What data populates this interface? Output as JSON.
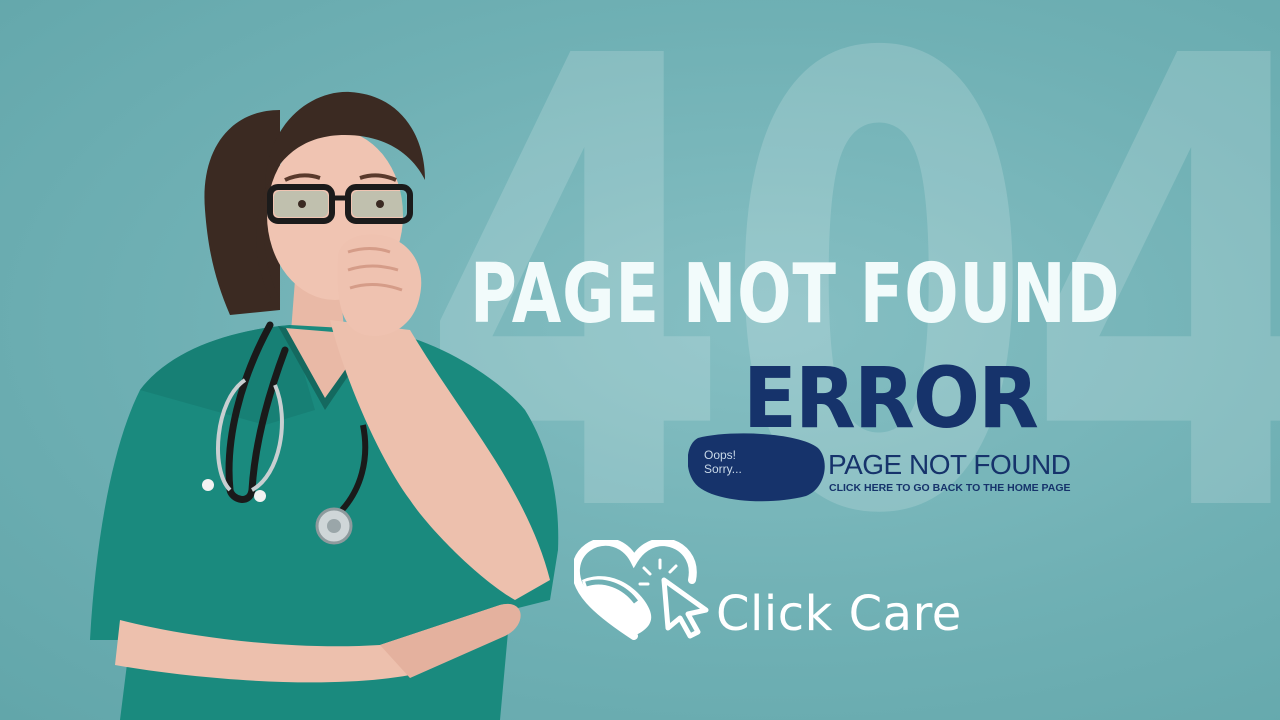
{
  "background_text": "404",
  "headline": "PAGE NOT FOUND",
  "badge": {
    "oops_line1": "Oops!",
    "oops_line2": "Sorry...",
    "error": "ERROR",
    "subtitle": "PAGE NOT FOUND",
    "cta": "CLICK HERE TO GO BACK TO THE HOME PAGE"
  },
  "brand": {
    "name": "Click Care"
  },
  "colors": {
    "background": "#6fb0b4",
    "navy": "#16336b",
    "scrubs": "#1a8a7e",
    "headline": "#f2fbfb"
  },
  "icons": [
    "heart-cursor-logo-icon",
    "stethoscope-icon"
  ]
}
